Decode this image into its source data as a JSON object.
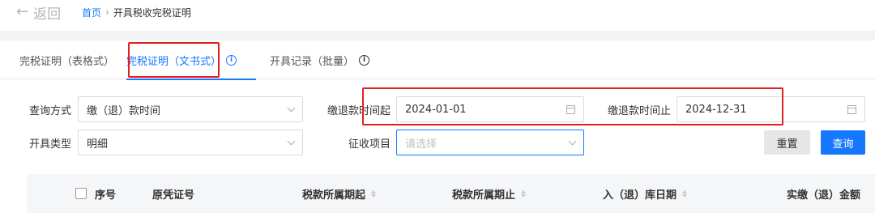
{
  "header": {
    "back_label": "返回",
    "breadcrumb_home": "首页",
    "breadcrumb_separator": "›",
    "breadcrumb_current": "开具税收完税证明"
  },
  "tabs": [
    {
      "label": "完税证明（表格式）",
      "active": false,
      "has_info": false
    },
    {
      "label": "完税证明（文书式）",
      "active": true,
      "has_info": true
    },
    {
      "label": "开具记录（批量）",
      "active": false,
      "has_info": true
    }
  ],
  "form": {
    "query_method_label": "查询方式",
    "query_method_value": "缴（退）款时间",
    "start_date_label": "缴退款时间起",
    "start_date_value": "2024-01-01",
    "end_date_label": "缴退款时间止",
    "end_date_value": "2024-12-31",
    "issue_type_label": "开具类型",
    "issue_type_value": "明细",
    "levy_item_label": "征收项目",
    "levy_item_placeholder": "请选择",
    "reset_label": "重置",
    "query_label": "查询"
  },
  "table": {
    "columns": [
      "序号",
      "原凭证号",
      "税款所属期起",
      "税款所属期止",
      "入（退）库日期",
      "实缴（退）金额"
    ]
  },
  "colors": {
    "accent": "#1677ff",
    "highlight_box": "#e02020",
    "band": "#f2f3f5"
  }
}
